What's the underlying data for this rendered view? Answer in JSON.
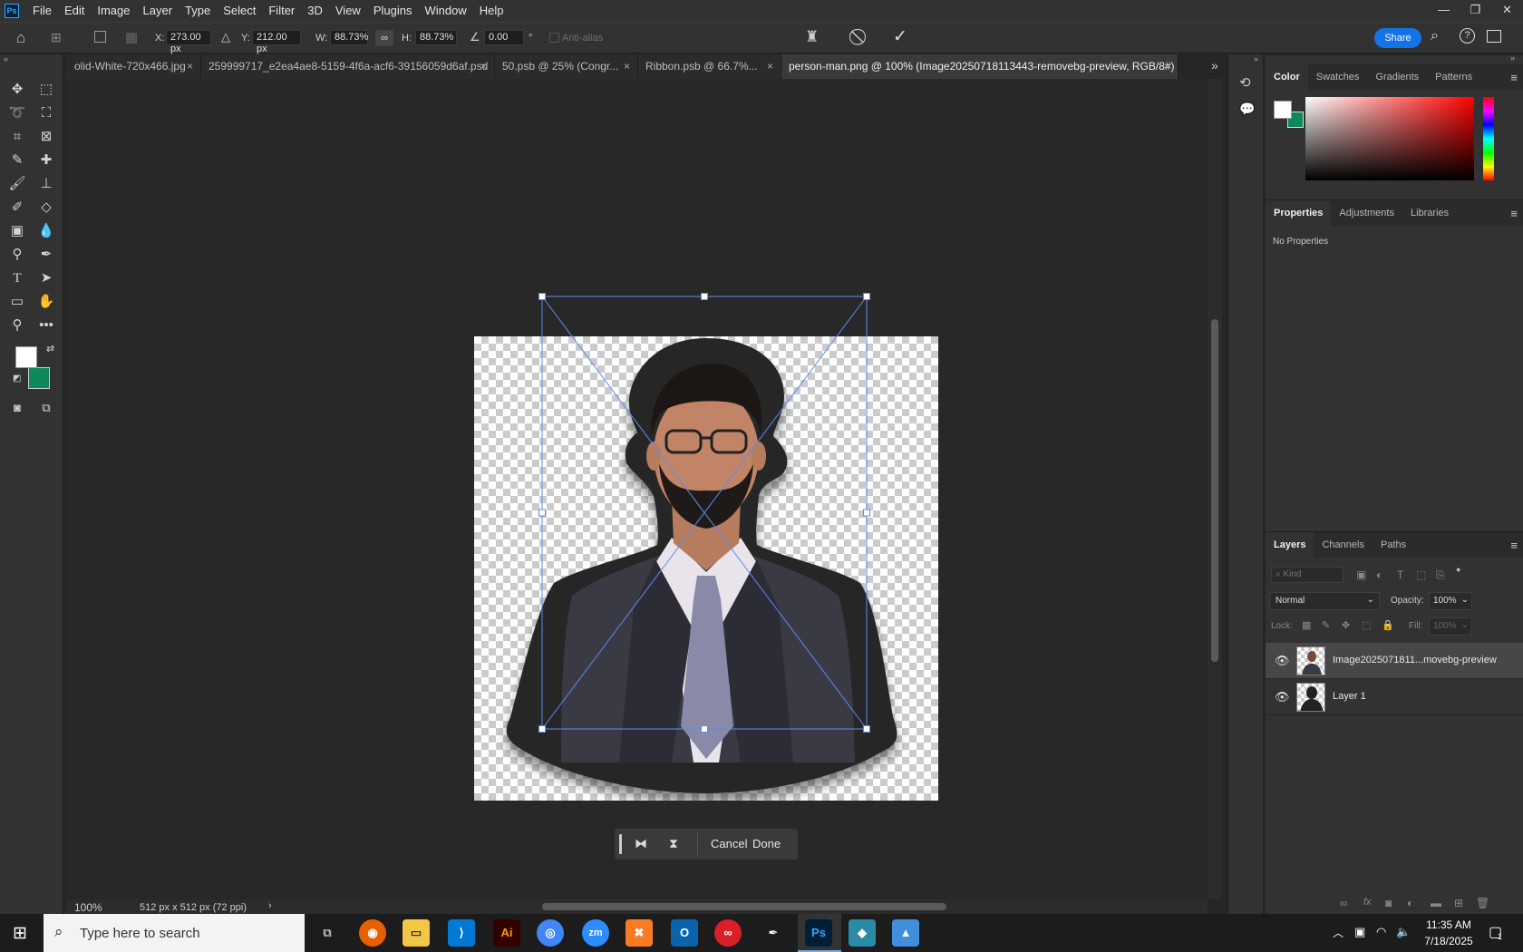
{
  "app": {
    "logo": "Ps",
    "menu": [
      "File",
      "Edit",
      "Image",
      "Layer",
      "Type",
      "Select",
      "Filter",
      "3D",
      "View",
      "Plugins",
      "Window",
      "Help"
    ]
  },
  "options": {
    "x_label": "X:",
    "x_value": "273.00 px",
    "y_label": "Y:",
    "y_value": "212.00 px",
    "w_label": "W:",
    "w_value": "88.73%",
    "h_label": "H:",
    "h_value": "88.73%",
    "angle_value": "0.00",
    "angle_unit": "°",
    "antialias_label": "Anti-alias",
    "share_label": "Share"
  },
  "tabs": [
    {
      "label": "olid-White-720x466.jpg",
      "active": false
    },
    {
      "label": "259999717_e2ea4ae8-5159-4f6a-acf6-39156059d6af.psd",
      "active": false
    },
    {
      "label": "50.psb @ 25% (Congr...",
      "active": false
    },
    {
      "label": "Ribbon.psb @ 66.7%...",
      "active": false
    },
    {
      "label": "person-man.png @ 100% (Image20250718113443-removebg-preview, RGB/8#)",
      "active": true
    }
  ],
  "tab_close": "×",
  "context_bar": {
    "cancel": "Cancel",
    "done": "Done"
  },
  "status": {
    "zoom": "100%",
    "doc_info": "512 px x 512 px (72 ppi)"
  },
  "color_panel": {
    "tabs": [
      "Color",
      "Swatches",
      "Gradients",
      "Patterns"
    ],
    "foreground": "#ffffff",
    "background": "#0e8a5a",
    "hue_color": "#ff0000"
  },
  "properties_panel": {
    "tabs": [
      "Properties",
      "Adjustments",
      "Libraries"
    ],
    "message": "No Properties"
  },
  "layers_panel": {
    "tabs": [
      "Layers",
      "Channels",
      "Paths"
    ],
    "kind_placeholder": "Kind",
    "blend_mode": "Normal",
    "opacity_label": "Opacity:",
    "opacity_value": "100%",
    "lock_label": "Lock:",
    "fill_label": "Fill:",
    "fill_value": "100%",
    "layers": [
      {
        "name": "Image2025071811...movebg-preview",
        "selected": true
      },
      {
        "name": "Layer 1",
        "selected": false
      }
    ]
  },
  "taskbar": {
    "search_placeholder": "Type here to search",
    "time": "11:35 AM",
    "date": "7/18/2025",
    "notification_count": "1",
    "apps": [
      "task-view",
      "firefox",
      "file-explorer",
      "vs-code",
      "illustrator",
      "chrome",
      "zoom",
      "xampp",
      "outlook",
      "creative-cloud",
      "pen-tool",
      "photoshop",
      "app-gem",
      "app-photos"
    ]
  }
}
